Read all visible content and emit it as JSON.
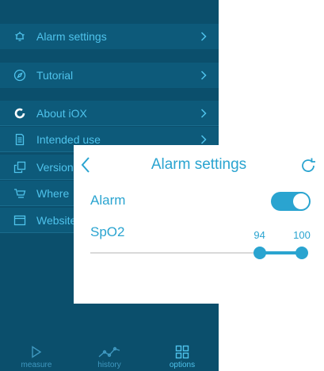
{
  "menu": {
    "items": [
      {
        "label": "Alarm settings",
        "icon": "bell-icon"
      },
      {
        "label": "Tutorial",
        "icon": "compass-icon"
      },
      {
        "label": "About iOX",
        "icon": "ring-logo-icon"
      },
      {
        "label": "Intended use",
        "icon": "document-icon"
      },
      {
        "label": "Version",
        "icon": "copy-icon"
      },
      {
        "label": "Where",
        "icon": "cart-icon"
      },
      {
        "label": "Website",
        "icon": "browser-icon"
      }
    ]
  },
  "tabbar": {
    "measure": "measure",
    "history": "history",
    "options": "options"
  },
  "popup": {
    "title": "Alarm settings",
    "alarm_label": "Alarm",
    "alarm_on": true,
    "spo2_label": "SpO2",
    "slider": {
      "min_value": "94",
      "max_value": "100",
      "range_min": 70,
      "range_max": 100,
      "low": 94,
      "high": 100
    }
  },
  "colors": {
    "background": "#0b4f6c",
    "accent": "#4fc3ec",
    "popup_accent": "#2aa4d0"
  }
}
